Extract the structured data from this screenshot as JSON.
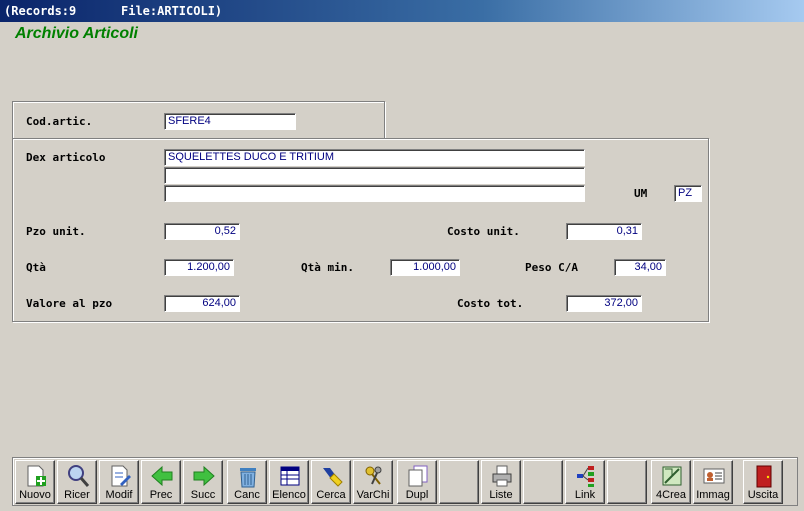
{
  "titlebar": {
    "records": "(Records:9",
    "file": "File:ARTICOLI)"
  },
  "app_title": "Archivio Articoli",
  "form": {
    "cod_label": "Cod.artic.",
    "cod_value": "SFERE4",
    "dex_label": "Dex articolo",
    "dex_line1": "SQUELETTES DUCO E TRITIUM",
    "dex_line2": "",
    "dex_line3": "",
    "um_label": "UM",
    "um_value": "PZ",
    "pzo_label": "Pzo unit.",
    "pzo_value": "0,52",
    "costo_unit_label": "Costo unit.",
    "costo_unit_value": "0,31",
    "qta_label": "Qtà",
    "qta_value": "1.200,00",
    "qta_min_label": "Qtà min.",
    "qta_min_value": "1.000,00",
    "peso_label": "Peso C/A",
    "peso_value": "34,00",
    "valore_label": "Valore al pzo",
    "valore_value": "624,00",
    "costo_tot_label": "Costo tot.",
    "costo_tot_value": "372,00"
  },
  "toolbar": {
    "nuovo": "Nuovo",
    "ricer": "Ricer",
    "modif": "Modif",
    "prec": "Prec",
    "succ": "Succ",
    "canc": "Canc",
    "elenco": "Elenco",
    "cerca": "Cerca",
    "varchi": "VarChi",
    "dupl": "Dupl",
    "liste": "Liste",
    "link": "Link",
    "crea4": "4Crea",
    "immag": "Immag",
    "uscita": "Uscita"
  }
}
